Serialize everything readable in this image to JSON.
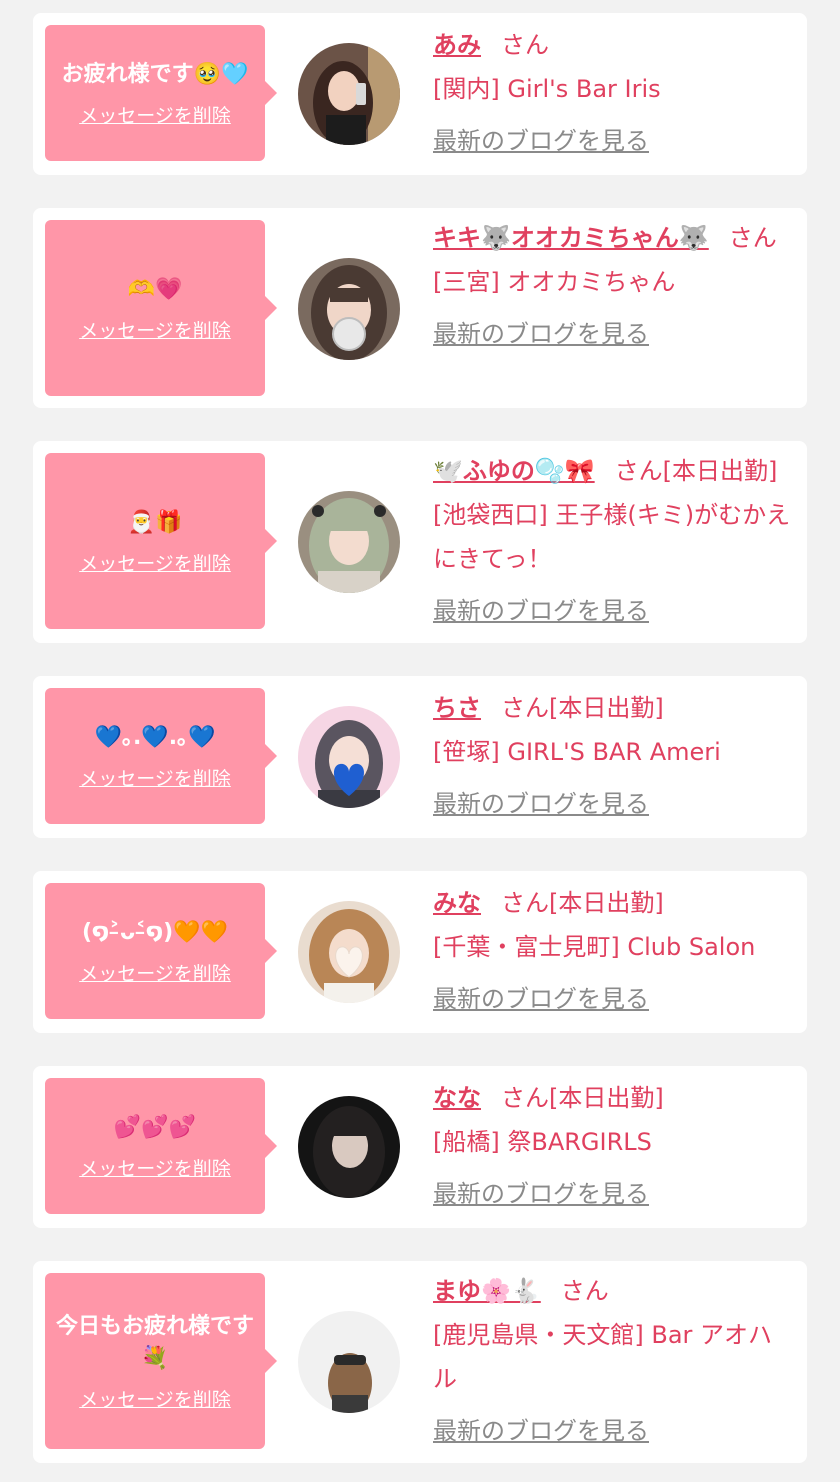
{
  "delete_label": "メッセージを削除",
  "blog_label": "最新のブログを見る",
  "colors": {
    "background": "#f2f2f2",
    "card": "#ffffff",
    "bubble": "#ff96a8",
    "accent_text": "#e0405f",
    "link_gray": "#8a8a8a"
  },
  "cards": [
    {
      "message": "お疲れ様です🥹🩵",
      "name": "あみ",
      "suffix": "さん",
      "shop": "[関内] Girl's Bar Iris"
    },
    {
      "message": "🫶💗",
      "name": "キキ🐺オオカミちゃん🐺",
      "suffix": "さん",
      "shop": "[三宮] オオカミちゃん"
    },
    {
      "message": "🎅🎁",
      "name": "🕊️ふゆの🫧🎀",
      "suffix": "さん[本日出勤]",
      "shop": "[池袋西口] 王子様(キミ)がむかえにきてっ！"
    },
    {
      "message": "💙｡.💙.｡💙",
      "name": "ちさ",
      "suffix": "さん[本日出勤]",
      "shop": "[笹塚] GIRL'S BAR Ameri"
    },
    {
      "message": "(໑˃̵ᴗ˂̵໑)🧡🧡",
      "name": "みな",
      "suffix": "さん[本日出勤]",
      "shop": "[千葉・富士見町] Club Salon"
    },
    {
      "message": "💕💕💕",
      "name": "なな",
      "suffix": "さん[本日出勤]",
      "shop": "[船橋] 祭BARGIRLS"
    },
    {
      "message": "今日もお疲れ様です💐",
      "name": "まゆ🌸🐇",
      "suffix": "さん",
      "shop": "[鹿児島県・天文館] Bar アオハル"
    }
  ]
}
